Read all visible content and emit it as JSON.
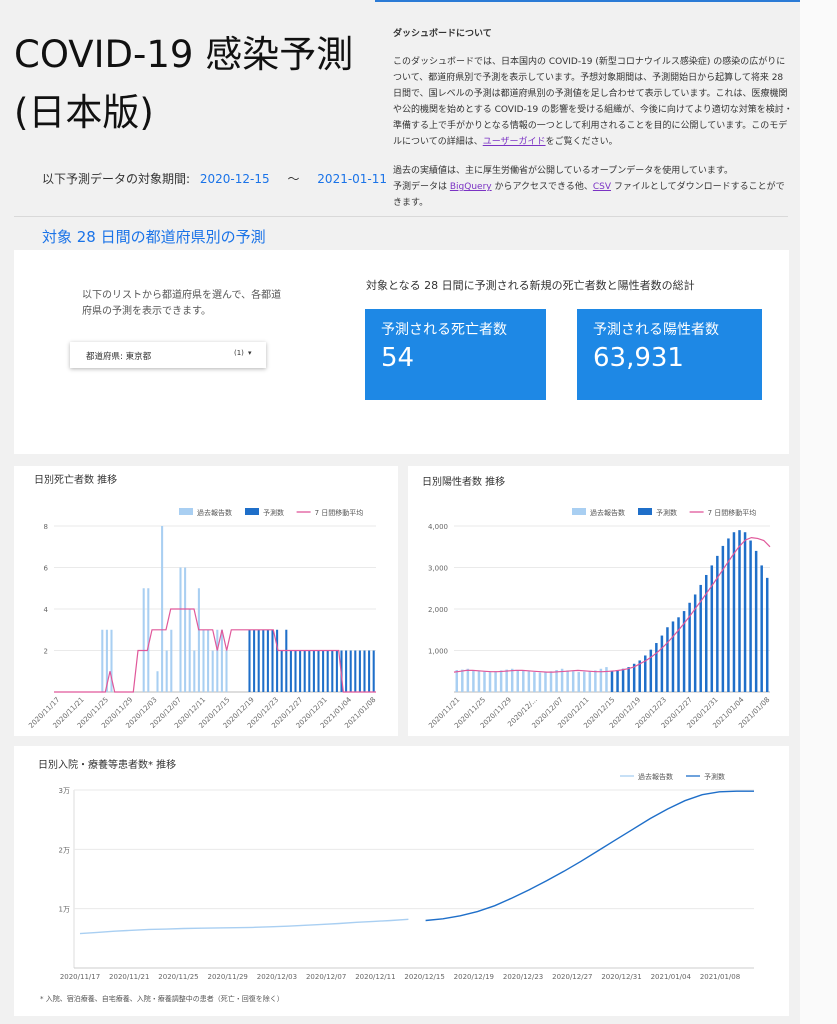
{
  "header": {
    "title_line1": "COVID-19 感染予測",
    "title_line2": "(日本版)",
    "period_label": "以下予測データの対象期間:",
    "period_start": "2020-12-15",
    "period_sep": "〜",
    "period_end": "2021-01-11"
  },
  "about": {
    "heading": "ダッシュボードについて",
    "p1": "このダッシュボードでは、日本国内の COVID-19 (新型コロナウイルス感染症) の感染の広がりについて、都道府県別で予測を表示しています。予想対象期間は、予測開始日から起算して将来 28 日間で、国レベルの予測は都道府県別の予測値を足し合わせて表示しています。これは、医療機関や公的機関を始めとする COVID-19 の影響を受ける組織が、今後に向けてより適切な対策を検討・準備する上で手がかりとなる情報の一つとして利用されることを目的に公開しています。このモデルについての詳細は、",
    "p1_link": "ユーザーガイド",
    "p1_end": "をご覧ください。",
    "p2_line1": "過去の実績値は、主に厚生労働省が公開しているオープンデータを使用しています。",
    "p2_pre": "予測データは ",
    "p2_link1": "BigQuery",
    "p2_mid": " からアクセスできる他、",
    "p2_link2": "CSV",
    "p2_end": " ファイルとしてダウンロードすることができます。"
  },
  "section_title": "対象 28 日間の都道府県別の予測",
  "selector": {
    "text": "以下のリストから都道府県を選んで、各都道府県の予測を表示できます。",
    "dropdown_label": "都道府県: 東京都",
    "dropdown_count": "(1)",
    "chevron_icon": "caret-down-icon"
  },
  "totals": {
    "title": "対象となる 28 日間に予測される新規の死亡者数と陽性者数の総計",
    "deaths_label": "予測される死亡者数",
    "deaths_value": "54",
    "cases_label": "予測される陽性者数",
    "cases_value": "63,931"
  },
  "colors": {
    "past": "#a9cff2",
    "forecast": "#1f6fc9",
    "avg": "#e0589a",
    "kpi": "#1e88e5"
  },
  "chart_data": [
    {
      "type": "bar",
      "title": "日別死亡者数 推移",
      "legend": [
        "過去報告数",
        "予測数",
        "7 日間移動平均"
      ],
      "legend_position": "top-right",
      "x_ticks": [
        "2020/11/17",
        "2020/11/21",
        "2020/11/25",
        "2020/11/29",
        "2020/12/03",
        "2020/12/07",
        "2020/12/11",
        "2020/12/15",
        "2020/12/19",
        "2020/12/23",
        "2020/12/27",
        "2020/12/31",
        "2021/01/04",
        "2021/01/08"
      ],
      "y_ticks": [
        "2",
        "4",
        "6",
        "8"
      ],
      "ylim": [
        0,
        8
      ],
      "past": [
        0,
        0,
        0,
        0,
        0,
        0,
        0,
        0,
        0,
        0,
        3,
        3,
        3,
        0,
        0,
        0,
        0,
        0,
        0,
        5,
        5,
        0,
        1,
        8,
        2,
        3,
        0,
        6,
        6,
        4,
        2,
        5,
        3,
        3,
        2,
        3,
        3,
        2,
        0,
        0,
        0,
        0
      ],
      "forecast": [
        3,
        3,
        3,
        3,
        3,
        3,
        3,
        2,
        3,
        2,
        2,
        2,
        2,
        2,
        2,
        2,
        2,
        2,
        2,
        2,
        2,
        2,
        2,
        2,
        2,
        2,
        2,
        2
      ],
      "avg": [
        0,
        0,
        0,
        0,
        0,
        0,
        0,
        0,
        0,
        0,
        0,
        0,
        1,
        0,
        0,
        0,
        0,
        0,
        2,
        2,
        2,
        3,
        3,
        3,
        3,
        4,
        4,
        4,
        4,
        4,
        4,
        3,
        3,
        3,
        3,
        2,
        3,
        2,
        3,
        3,
        3,
        3,
        3,
        3,
        3,
        3,
        3,
        3,
        2,
        2,
        2,
        2,
        2,
        2,
        2,
        2,
        2,
        2,
        2,
        2,
        2,
        2,
        0,
        0,
        0,
        0,
        0,
        0,
        0,
        0
      ],
      "forecast_start_index": 28
    },
    {
      "type": "bar",
      "title": "日別陽性者数 推移",
      "legend": [
        "過去報告数",
        "予測数",
        "7 日間移動平均"
      ],
      "legend_position": "top-right",
      "x_ticks": [
        "2020/11/21",
        "2020/11/25",
        "2020/11/29",
        "2020/12/...",
        "2020/12/07",
        "2020/12/11",
        "2020/12/15",
        "2020/12/19",
        "2020/12/23",
        "2020/12/27",
        "2020/12/31",
        "2021/01/04",
        "2021/01/08"
      ],
      "y_ticks": [
        "1,000",
        "2,000",
        "3,000",
        "4,000"
      ],
      "ylim": [
        0,
        4000
      ],
      "past": [
        530,
        540,
        560,
        520,
        510,
        490,
        480,
        500,
        520,
        540,
        560,
        510,
        520,
        500,
        480,
        470,
        490,
        500,
        530,
        560,
        520,
        500,
        480,
        490,
        500,
        520,
        560,
        600
      ],
      "forecast": [
        500,
        530,
        560,
        600,
        680,
        760,
        880,
        1020,
        1180,
        1360,
        1560,
        1700,
        1800,
        1950,
        2150,
        2350,
        2580,
        2820,
        3050,
        3280,
        3520,
        3700,
        3850,
        3900,
        3850,
        3650,
        3400,
        3050,
        2750
      ],
      "avg": [
        480,
        500,
        520,
        520,
        510,
        500,
        490,
        490,
        500,
        510,
        520,
        520,
        510,
        500,
        490,
        480,
        480,
        490,
        500,
        510,
        520,
        510,
        500,
        490,
        490,
        500,
        510,
        530,
        560,
        600,
        680,
        760,
        860,
        980,
        1120,
        1280,
        1450,
        1630,
        1820,
        2020,
        2220,
        2430,
        2640,
        2860,
        3080,
        3300,
        3500,
        3660,
        3720,
        3700,
        3650,
        3500
      ]
    },
    {
      "type": "line",
      "title": "日別入院・療養等患者数* 推移",
      "legend": [
        "過去報告数",
        "予測数"
      ],
      "legend_position": "top-right",
      "x_ticks": [
        "2020/11/17",
        "2020/11/21",
        "2020/11/25",
        "2020/11/29",
        "2020/12/03",
        "2020/12/07",
        "2020/12/11",
        "2020/12/15",
        "2020/12/19",
        "2020/12/23",
        "2020/12/27",
        "2020/12/31",
        "2021/01/04",
        "2021/01/08"
      ],
      "y_ticks": [
        "1万",
        "2万",
        "3万"
      ],
      "ylim": [
        0,
        30000
      ],
      "past": [
        5800,
        6000,
        6200,
        6350,
        6500,
        6550,
        6650,
        6700,
        6750,
        6800,
        6850,
        6950,
        7050,
        7200,
        7350,
        7500,
        7700,
        7850,
        8000,
        8200
      ],
      "forecast": [
        8000,
        8300,
        8800,
        9500,
        10500,
        11800,
        13200,
        14700,
        16300,
        18000,
        19800,
        21600,
        23400,
        25200,
        26800,
        28200,
        29200,
        29700,
        29800,
        29800
      ]
    }
  ],
  "footnote": "* 入院、宿泊療養、自宅療養、入院・療養調整中の患者（死亡・回復を除く）"
}
